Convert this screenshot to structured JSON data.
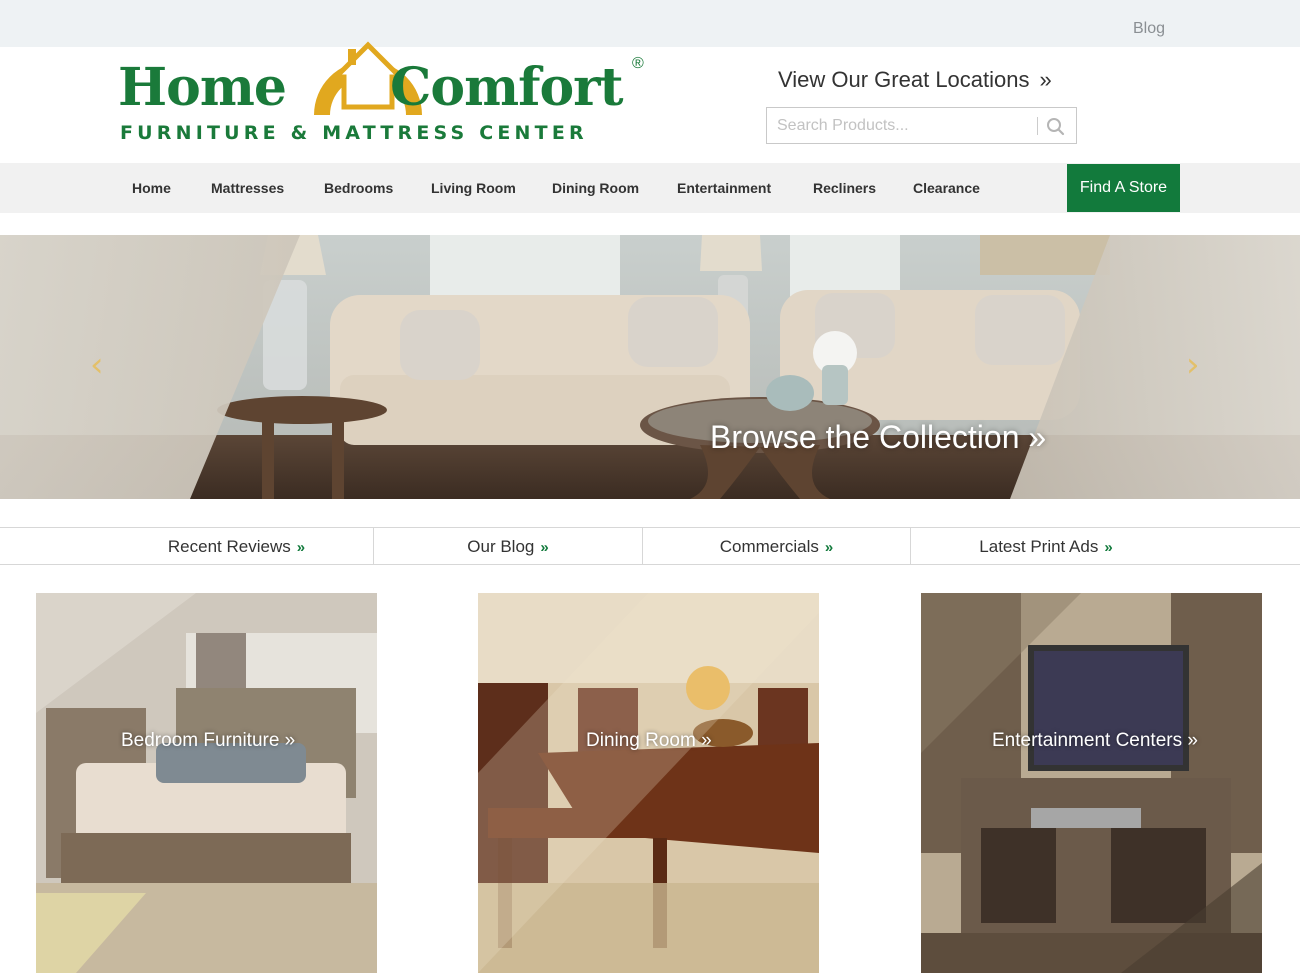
{
  "topbar": {
    "blog": "Blog"
  },
  "logo": {
    "home": "Home",
    "comfort": "Comfort",
    "reg": "®",
    "tagline": "FURNITURE & MATTRESS CENTER"
  },
  "header": {
    "locations": "View Our Great Locations",
    "locations_icon": "double-chevron-right-icon",
    "search_placeholder": "Search Products...",
    "search_icon": "search-icon"
  },
  "nav": {
    "items": [
      "Home",
      "Mattresses",
      "Bedrooms",
      "Living Room",
      "Dining Room",
      "Entertainment",
      "Recliners",
      "Clearance"
    ],
    "find_store": "Find A Store"
  },
  "hero": {
    "prev": "‹",
    "next": "›",
    "cta": "Browse the Collection"
  },
  "tabs": [
    "Recent Reviews",
    "Our Blog",
    "Commercials",
    "Latest Print Ads"
  ],
  "tiles": [
    "Bedroom Furniture",
    "Dining Room",
    "Entertainment Centers"
  ],
  "colors": {
    "brand_green": "#127a3c",
    "logo_gold": "#e1a81f",
    "topbar": "#eef2f4",
    "nav_bg": "#f1f1f1"
  }
}
